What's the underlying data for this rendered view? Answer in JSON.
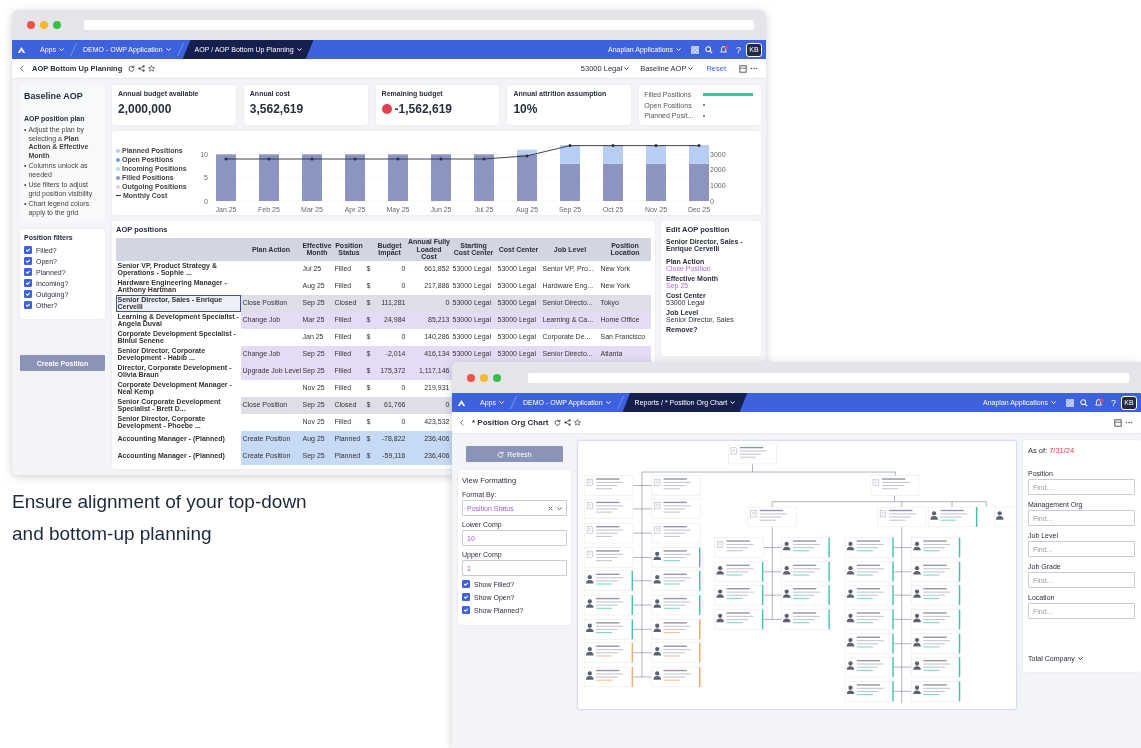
{
  "back_window": {
    "nav": {
      "items": [
        {
          "label": "Apps",
          "selected": false
        },
        {
          "label": "DEMO - OWP Application",
          "selected": false
        },
        {
          "label": "AOP / AOP Bottom Up Planning",
          "selected": true
        }
      ],
      "app_menu": "Anaplan Applications",
      "help": "?",
      "avatar": "KB"
    },
    "toolbar": {
      "title": "AOP Bottom Up Planning",
      "dropdowns": [
        "53000 Legal",
        "Baseline AOP"
      ],
      "reset": "Reset"
    },
    "sidebar": {
      "title": "Baseline AOP",
      "plan_title": "AOP position plan",
      "plan_notes": [
        {
          "bullet": "•",
          "text": "Adjust the plan by selecting a **Plan Action & Effective Month**"
        },
        {
          "bullet": "•",
          "text": "Columns unlock as needed"
        },
        {
          "bullet": "•",
          "text": "Use filters to adjust grid position visibility"
        },
        {
          "bullet": "•",
          "text": "Chart legend colors apply to the grid"
        }
      ],
      "filters_title": "Position filters",
      "filters": [
        {
          "label": "Filled?",
          "checked": true
        },
        {
          "label": "Open?",
          "checked": true
        },
        {
          "label": "Planned?",
          "checked": true
        },
        {
          "label": "Incoming?",
          "checked": true
        },
        {
          "label": "Outgoing?",
          "checked": true
        },
        {
          "label": "Other?",
          "checked": true
        }
      ],
      "create_button": "Create Position"
    },
    "kpis": [
      {
        "label": "Annual budget available",
        "value": "2,000,000",
        "alert": false
      },
      {
        "label": "Annual cost",
        "value": "3,562,619",
        "alert": false
      },
      {
        "label": "Remaining budget",
        "value": "-1,562,619",
        "alert": true
      },
      {
        "label": "Annual attrition assumption",
        "value": "10%",
        "alert": false
      }
    ],
    "mini_chart": {
      "labels": [
        "Filled Positions",
        "Open Positions",
        "Planned Posit..."
      ]
    },
    "chart": {
      "chart_data": {
        "type": "bar",
        "stacked": true,
        "categories": [
          "Jan 25",
          "Feb 25",
          "Mar 25",
          "Apr 25",
          "May 25",
          "Jun 25",
          "Jul 25",
          "Aug 25",
          "Sep 25",
          "Oct 25",
          "Nov 25",
          "Dec 25"
        ],
        "ylim": [
          0,
          12
        ],
        "yticks": [
          0,
          5,
          10
        ],
        "y2lim": [
          0,
          3600
        ],
        "y2ticks": [
          0,
          1000,
          2000,
          3000
        ],
        "series": [
          {
            "name": "Planned Positions",
            "color": "#b7cdf3",
            "values": [
              0,
              0,
              0,
              0,
              0,
              0,
              0,
              1,
              4,
              4,
              4,
              4
            ]
          },
          {
            "name": "Open Positions",
            "color": "#6f9ee6",
            "values": [
              0,
              0,
              0,
              0,
              0,
              0,
              0,
              0,
              0,
              0,
              0,
              0
            ]
          },
          {
            "name": "Incoming Positions",
            "color": "#a9e2dd",
            "values": [
              0,
              0,
              0,
              0,
              0,
              0,
              0,
              0,
              0,
              0,
              0,
              0
            ]
          },
          {
            "name": "Filled Positions",
            "color": "#8c95c2",
            "values": [
              10,
              10,
              10,
              10,
              10,
              10,
              10,
              10,
              8,
              8,
              8,
              8
            ]
          },
          {
            "name": "Outgoing Positions",
            "color": "#f4c6cf",
            "values": [
              0,
              0,
              0,
              0,
              0,
              0,
              0,
              0,
              0,
              0,
              0,
              0
            ]
          },
          {
            "name": "Monthly Cost",
            "color": "#2b2f3a",
            "type": "line",
            "axis": "y2",
            "values": [
              2700,
              2700,
              2700,
              2700,
              2700,
              2700,
              2700,
              2900,
              3560,
              3560,
              3560,
              3560
            ]
          }
        ]
      }
    },
    "positions": {
      "title": "AOP positions",
      "headings": {
        "plan_action": "Plan Action",
        "effective_month": "Effective Month",
        "status": "Position Status",
        "budget_impact": "Budget Impact",
        "annual_cost": "Annual Fully Loaded Cost",
        "starting_cost_center": "Starting Cost Center",
        "cost_center": "Cost Center",
        "job_level": "Job Level",
        "location": "Position Location"
      },
      "rows": [
        {
          "selected": false,
          "position": "Senior VP, Product Strategy & Operations - Sophie ...",
          "effective_month": "Jul 25",
          "status": "Filled",
          "currency": "$",
          "budget_impact": "0",
          "annual_cost": "661,852",
          "starting_cost_center": "53000 Legal",
          "cost_center": "53000 Legal",
          "job_level": "Senior VP, Pro...",
          "location": "New York"
        },
        {
          "selected": false,
          "position": "Hardware Engineering Manager - Anthony Hartman",
          "effective_month": "Aug 25",
          "status": "Filled",
          "currency": "$",
          "budget_impact": "0",
          "annual_cost": "217,886",
          "starting_cost_center": "53000 Legal",
          "cost_center": "53000 Legal",
          "job_level": "Hardware Eng...",
          "location": "New York"
        },
        {
          "selected": true,
          "color": "#dedfe6",
          "position": "Senior Director, Sales - Enrique Cervelli",
          "plan_action": "Close Position",
          "effective_month": "Sep 25",
          "status": "Closed",
          "currency": "$",
          "budget_impact": "111,281",
          "annual_cost": "0",
          "starting_cost_center": "53000 Legal",
          "cost_center": "53000 Legal",
          "job_level": "Senior Directo...",
          "location": "Tokyo"
        },
        {
          "selected": false,
          "color": "#e4dcf5",
          "position": "Learning & Development Specialist - Angela Duval",
          "plan_action": "Change Job",
          "effective_month": "Mar 25",
          "status": "Filled",
          "currency": "$",
          "budget_impact": "24,984",
          "annual_cost": "85,213",
          "starting_cost_center": "53000 Legal",
          "cost_center": "53000 Legal",
          "job_level": "Learning & Ca...",
          "location": "Home Office"
        },
        {
          "selected": false,
          "position": "Corporate Development Specialist - Binlui Senene",
          "effective_month": "Jan 25",
          "status": "Filled",
          "currency": "$",
          "budget_impact": "0",
          "annual_cost": "140,286",
          "starting_cost_center": "53000 Legal",
          "cost_center": "53000 Legal",
          "job_level": "Corporate De...",
          "location": "San Francisco"
        },
        {
          "selected": false,
          "color": "#e4dcf5",
          "position": "Senior Director, Corporate Development - Habib ...",
          "plan_action": "Change Job",
          "effective_month": "Sep 25",
          "status": "Filled",
          "currency": "$",
          "budget_impact": "-2,014",
          "annual_cost": "416,134",
          "starting_cost_center": "53000 Legal",
          "cost_center": "53000 Legal",
          "job_level": "Senior Directo...",
          "location": "Atlanta"
        },
        {
          "selected": false,
          "color": "#e4dcf5",
          "position": "Director, Corporate Development - Olivia Braun",
          "plan_action": "Upgrade Job Level",
          "effective_month": "Sep 25",
          "status": "Filled",
          "currency": "$",
          "budget_impact": "175,372",
          "annual_cost": "1,117,146"
        },
        {
          "selected": false,
          "position": "Corporate Development Manager - Neal Kemp",
          "effective_month": "Nov 25",
          "status": "Filled",
          "currency": "$",
          "budget_impact": "0",
          "annual_cost": "219,931"
        },
        {
          "selected": false,
          "color": "#dedfe6",
          "position": "Senior Corporate Development Specialist - Brett D...",
          "plan_action": "Close Position",
          "effective_month": "Sep 25",
          "status": "Closed",
          "currency": "$",
          "budget_impact": "61,766",
          "annual_cost": "0"
        },
        {
          "selected": false,
          "position": "Senior Director, Corporate Development - Phoebe ...",
          "effective_month": "Nov 25",
          "status": "Filled",
          "currency": "$",
          "budget_impact": "0",
          "annual_cost": "423,532"
        },
        {
          "selected": false,
          "color": "#c6daf6",
          "position": "Accounting Manager - (Planned)",
          "plan_action": "Create Position",
          "effective_month": "Aug 25",
          "status": "Planned",
          "currency": "$",
          "budget_impact": "-78,822",
          "annual_cost": "236,406"
        },
        {
          "selected": false,
          "color": "#c6daf6",
          "position": "Accounting Manager - (Planned)",
          "plan_action": "Create Position",
          "effective_month": "Sep 25",
          "status": "Planned",
          "currency": "$",
          "budget_impact": "-59,116",
          "annual_cost": "236,406"
        }
      ]
    },
    "edit": {
      "title": "Edit AOP position",
      "subtitle": "Senior Director, Sales - Enrique Cervelli",
      "fields": [
        {
          "label": "Plan Action",
          "value": "Close Position",
          "changed": true
        },
        {
          "label": "Effective Month",
          "value": "Sep 25",
          "changed": true
        },
        {
          "label": "Cost Center",
          "value": "53000 Legal",
          "changed": false
        },
        {
          "label": "Job Level",
          "value": "Senior Director, Sales",
          "changed": false
        },
        {
          "label": "Remove?"
        }
      ]
    }
  },
  "front_window": {
    "nav": {
      "items": [
        {
          "label": "Apps",
          "selected": false
        },
        {
          "label": "DEMO - OWP Application",
          "selected": false
        },
        {
          "label": "Reports / * Position Org Chart",
          "selected": true
        }
      ],
      "app_menu": "Anaplan Applications",
      "help": "?",
      "avatar": "KB"
    },
    "toolbar": {
      "title": "* Position Org Chart"
    },
    "refresh_button": "Refresh",
    "formatting": {
      "title": "View Formatting",
      "format_by_label": "Format By:",
      "format_by_value": "Position Status",
      "lower_label": "Lower Comp",
      "lower_value": "10",
      "upper_label": "Upper Comp",
      "upper_value": "1",
      "toggles": [
        {
          "label": "Show Filled?",
          "checked": true
        },
        {
          "label": "Show Open?",
          "checked": true
        },
        {
          "label": "Show Planned?",
          "checked": true
        }
      ]
    },
    "filters": {
      "as_of_label": "As of:",
      "as_of_value": "7/31/24",
      "fields": [
        {
          "label": "Position",
          "placeholder": "Find..."
        },
        {
          "label": "Management Org",
          "placeholder": "Find..."
        },
        {
          "label": "Job Level",
          "placeholder": "Find..."
        },
        {
          "label": "Job Grade",
          "placeholder": "Find..."
        },
        {
          "label": "Location",
          "placeholder": "Find..."
        }
      ],
      "scope": "Total Company"
    }
  },
  "caption": "Ensure alignment of your top-down and bottom-up planning"
}
